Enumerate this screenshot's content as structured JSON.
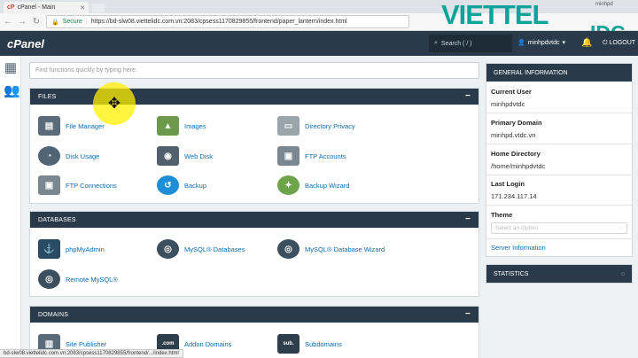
{
  "browser": {
    "tab_title": "cPanel - Main",
    "secure_label": "Secure",
    "url": "https://bd-slw08.viettelidc.com.vn:2083/cpsess1170829855/frontend/paper_lantern/index.html",
    "win_user": "minhpd",
    "status_url": "bd-slw08.viettelidc.com.vn:2083/cpsess1170829855/frontend/.../index.html"
  },
  "brand": {
    "line1": "VIETTEL",
    "line2": "IDC"
  },
  "topbar": {
    "logo": "cPanel",
    "search_placeholder": "Search ( / )",
    "username": "minhpdvtdc",
    "logout": "LOGOUT"
  },
  "quick_search": {
    "placeholder": "Find functions quickly by typing here."
  },
  "sections": {
    "files": {
      "title": "FILES",
      "items": [
        "File Manager",
        "Images",
        "Directory Privacy",
        "Disk Usage",
        "Web Disk",
        "FTP Accounts",
        "FTP Connections",
        "Backup",
        "Backup Wizard"
      ]
    },
    "databases": {
      "title": "DATABASES",
      "items": [
        "phpMyAdmin",
        "MySQL® Databases",
        "MySQL® Database Wizard",
        "Remote MySQL®"
      ]
    },
    "domains": {
      "title": "DOMAINS",
      "items": [
        "Site Publisher",
        "Addon Domains",
        "Subdomains"
      ]
    }
  },
  "general_info": {
    "title": "GENERAL INFORMATION",
    "current_user_label": "Current User",
    "current_user": "minhpdvtdc",
    "primary_domain_label": "Primary Domain",
    "primary_domain": "minhpd.vtdc.vn",
    "home_dir_label": "Home Directory",
    "home_dir": "/home/minhpdvtdc",
    "last_login_label": "Last Login",
    "last_login": "171.234.117.14",
    "theme_label": "Theme",
    "theme_placeholder": "Select an Option",
    "server_info": "Server Information"
  },
  "statistics": {
    "title": "STATISTICS"
  },
  "colors": {
    "header": "#293a4a",
    "link": "#0a6ab0",
    "brand": "#0fa39b"
  }
}
